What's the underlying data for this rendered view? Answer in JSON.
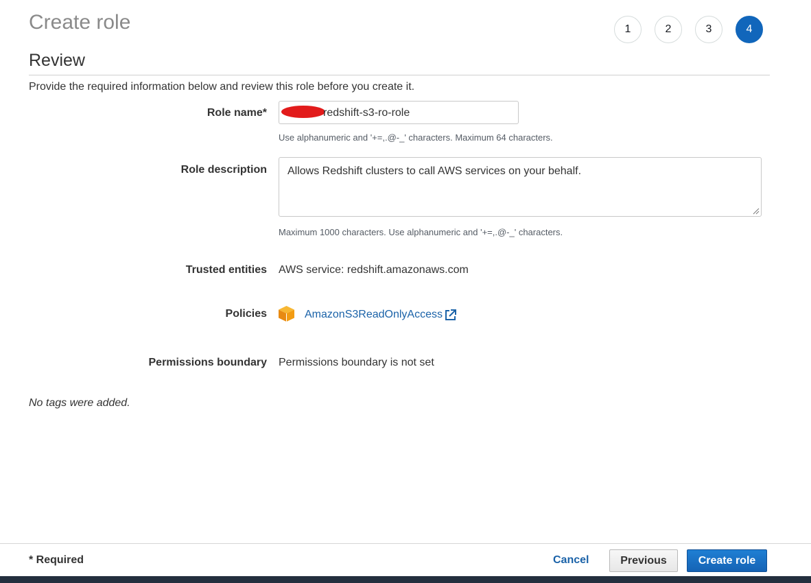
{
  "page": {
    "title": "Create role",
    "steps": [
      "1",
      "2",
      "3",
      "4"
    ],
    "active_step": "4",
    "section_title": "Review",
    "intro": "Provide the required information below and review this role before you create it."
  },
  "form": {
    "role_name": {
      "label": "Role name*",
      "value": "redshift-s3-ro-role",
      "hint": "Use alphanumeric and '+=,.@-_' characters. Maximum 64 characters."
    },
    "role_description": {
      "label": "Role description",
      "value": "Allows Redshift clusters to call AWS services on your behalf.",
      "hint": "Maximum 1000 characters. Use alphanumeric and '+=,.@-_' characters."
    },
    "trusted_entities": {
      "label": "Trusted entities",
      "value": "AWS service: redshift.amazonaws.com"
    },
    "policies": {
      "label": "Policies",
      "items": [
        {
          "name": "AmazonS3ReadOnlyAccess",
          "icon": "aws-policy-cube-icon"
        }
      ]
    },
    "permissions_boundary": {
      "label": "Permissions boundary",
      "value": "Permissions boundary is not set"
    },
    "tags_note": "No tags were added."
  },
  "footer": {
    "required_note": "* Required",
    "cancel_label": "Cancel",
    "previous_label": "Previous",
    "create_label": "Create role"
  },
  "colors": {
    "accent": "#1166bb",
    "link": "#1a62a8",
    "primary_button": "#1563b5",
    "bottom_bar": "#232f3e",
    "policy_icon": "#f39c12",
    "redaction": "#e21b1b"
  }
}
